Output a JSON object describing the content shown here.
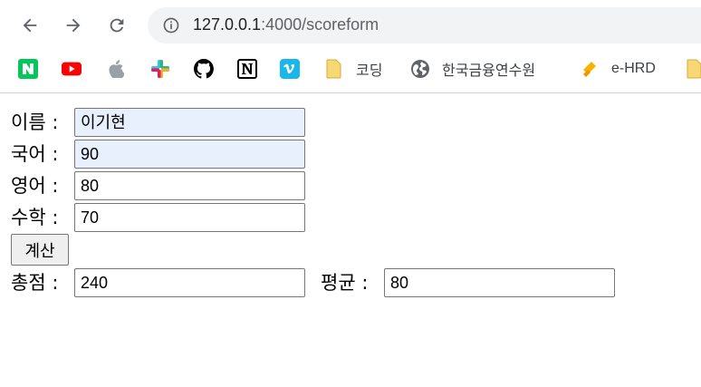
{
  "browser": {
    "url_host": "127.0.0.1",
    "url_rest": ":4000/scoreform",
    "bookmarks": [
      {
        "icon": "naver-icon",
        "label": ""
      },
      {
        "icon": "youtube-icon",
        "label": ""
      },
      {
        "icon": "apple-icon",
        "label": ""
      },
      {
        "icon": "slack-icon",
        "label": ""
      },
      {
        "icon": "github-icon",
        "label": ""
      },
      {
        "icon": "notion-icon",
        "label": ""
      },
      {
        "icon": "vimeo-icon",
        "label": ""
      },
      {
        "icon": "folder-icon",
        "label": "코딩"
      },
      {
        "icon": "globe-icon",
        "label": "한국금융연수원"
      },
      {
        "icon": "ehrd-icon",
        "label": "e-HRD"
      },
      {
        "icon": "folder-icon",
        "label": ""
      }
    ],
    "colors": {
      "naver": "#03c75a",
      "youtube": "#ff0000",
      "vimeo": "#1ab7ea",
      "folder": "#f8d775"
    }
  },
  "form": {
    "name_label": "이름 :",
    "name_value": "이기현",
    "korean_label": "국어 :",
    "korean_value": "90",
    "english_label": "영어 :",
    "english_value": "80",
    "math_label": "수학 :",
    "math_value": "70",
    "calc_button": "계산",
    "total_label": "총점 :",
    "total_value": "240",
    "average_label": "평균 :",
    "average_value": "80"
  }
}
